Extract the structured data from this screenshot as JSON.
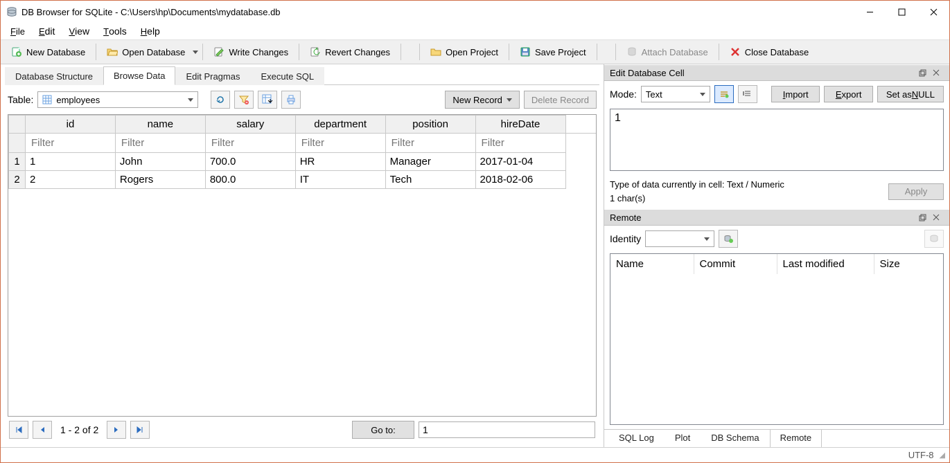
{
  "window": {
    "title": "DB Browser for SQLite - C:\\Users\\hp\\Documents\\mydatabase.db"
  },
  "menus": {
    "file": "File",
    "edit": "Edit",
    "view": "View",
    "tools": "Tools",
    "help": "Help"
  },
  "toolbar": {
    "new_db": "New Database",
    "open_db": "Open Database",
    "write_changes": "Write Changes",
    "revert_changes": "Revert Changes",
    "open_project": "Open Project",
    "save_project": "Save Project",
    "attach_db": "Attach Database",
    "close_db": "Close Database"
  },
  "tabs": {
    "structure": "Database Structure",
    "browse": "Browse Data",
    "pragmas": "Edit Pragmas",
    "execute": "Execute SQL"
  },
  "browse": {
    "table_label": "Table:",
    "table_selected": "employees",
    "new_record": "New Record",
    "delete_record": "Delete Record",
    "columns": [
      "id",
      "name",
      "salary",
      "department",
      "position",
      "hireDate"
    ],
    "filter_placeholder": "Filter",
    "rows": [
      {
        "n": "1",
        "cells": [
          "1",
          "John",
          "700.0",
          "HR",
          "Manager",
          "2017-01-04"
        ]
      },
      {
        "n": "2",
        "cells": [
          "2",
          "Rogers",
          "800.0",
          "IT",
          "Tech",
          "2018-02-06"
        ]
      }
    ],
    "pager_text": "1 - 2 of 2",
    "goto_label": "Go to:",
    "goto_value": "1"
  },
  "edit_cell": {
    "title": "Edit Database Cell",
    "mode_label": "Mode:",
    "mode_value": "Text",
    "import": "Import",
    "export": "Export",
    "set_null": "Set as NULL",
    "value": "1",
    "type_line": "Type of data currently in cell: Text / Numeric",
    "chars_line": "1 char(s)",
    "apply": "Apply"
  },
  "remote": {
    "title": "Remote",
    "identity_label": "Identity",
    "columns": {
      "name": "Name",
      "commit": "Commit",
      "last_modified": "Last modified",
      "size": "Size"
    }
  },
  "bottom_tabs": {
    "sql_log": "SQL Log",
    "plot": "Plot",
    "db_schema": "DB Schema",
    "remote": "Remote"
  },
  "status": {
    "encoding": "UTF-8"
  }
}
